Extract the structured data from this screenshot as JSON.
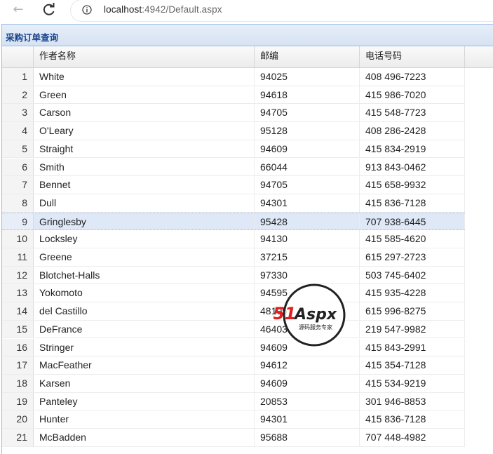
{
  "browser": {
    "url_host": "localhost",
    "url_rest": ":4942/Default.aspx"
  },
  "panel": {
    "title": "采购订单查询"
  },
  "grid": {
    "columns": [
      "作者名称",
      "邮编",
      "电话号码"
    ],
    "rows": [
      {
        "n": "1",
        "name": "White",
        "zip": "94025",
        "phone": "408 496-7223"
      },
      {
        "n": "2",
        "name": "Green",
        "zip": "94618",
        "phone": "415 986-7020"
      },
      {
        "n": "3",
        "name": "Carson",
        "zip": "94705",
        "phone": "415 548-7723"
      },
      {
        "n": "4",
        "name": "O'Leary",
        "zip": "95128",
        "phone": "408 286-2428"
      },
      {
        "n": "5",
        "name": "Straight",
        "zip": "94609",
        "phone": "415 834-2919"
      },
      {
        "n": "6",
        "name": "Smith",
        "zip": "66044",
        "phone": "913 843-0462"
      },
      {
        "n": "7",
        "name": "Bennet",
        "zip": "94705",
        "phone": "415 658-9932"
      },
      {
        "n": "8",
        "name": "Dull",
        "zip": "94301",
        "phone": "415 836-7128"
      },
      {
        "n": "9",
        "name": "Gringlesby",
        "zip": "95428",
        "phone": "707 938-6445"
      },
      {
        "n": "10",
        "name": "Locksley",
        "zip": "94130",
        "phone": "415 585-4620"
      },
      {
        "n": "11",
        "name": "Greene",
        "zip": "37215",
        "phone": "615 297-2723"
      },
      {
        "n": "12",
        "name": "Blotchet-Halls",
        "zip": "97330",
        "phone": "503 745-6402"
      },
      {
        "n": "13",
        "name": "Yokomoto",
        "zip": "94595",
        "phone": "415 935-4228"
      },
      {
        "n": "14",
        "name": "del Castillo",
        "zip": "48105",
        "phone": "615 996-8275"
      },
      {
        "n": "15",
        "name": "DeFrance",
        "zip": "46403",
        "phone": "219 547-9982"
      },
      {
        "n": "16",
        "name": "Stringer",
        "zip": "94609",
        "phone": "415 843-2991"
      },
      {
        "n": "17",
        "name": "MacFeather",
        "zip": "94612",
        "phone": "415 354-7128"
      },
      {
        "n": "18",
        "name": "Karsen",
        "zip": "94609",
        "phone": "415 534-9219"
      },
      {
        "n": "19",
        "name": "Panteley",
        "zip": "20853",
        "phone": "301 946-8853"
      },
      {
        "n": "20",
        "name": "Hunter",
        "zip": "94301",
        "phone": "415 836-7128"
      },
      {
        "n": "21",
        "name": "McBadden",
        "zip": "95688",
        "phone": "707 448-4982"
      }
    ],
    "selected_row": "9"
  },
  "watermark": {
    "brand": "51Aspx",
    "tagline": "源码服务专家"
  },
  "colors": {
    "header_title": "#15428b",
    "panel_border": "#99bbe8",
    "selected_row": "#dfe8f6"
  }
}
